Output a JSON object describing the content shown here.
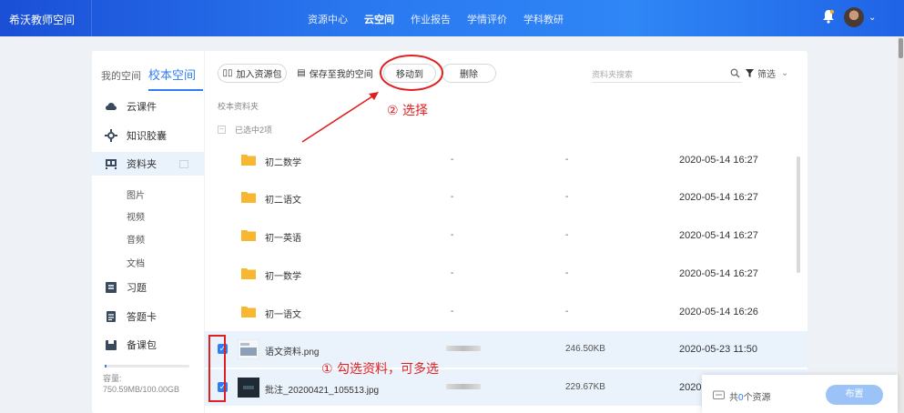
{
  "header": {
    "brand": "希沃教师空间",
    "nav": [
      {
        "label": "资源中心",
        "active": false
      },
      {
        "label": "云空间",
        "active": true
      },
      {
        "label": "作业报告",
        "active": false
      },
      {
        "label": "学情评价",
        "active": false
      },
      {
        "label": "学科教研",
        "active": false
      }
    ]
  },
  "sidebar": {
    "tabs": [
      "我的空间",
      "校本空间"
    ],
    "items": [
      {
        "label": "云课件",
        "icon": "cloud-icon"
      },
      {
        "label": "知识胶囊",
        "icon": "capsule-icon"
      },
      {
        "label": "资料夹",
        "icon": "folder-books-icon"
      },
      {
        "label": "习题",
        "icon": "exercise-icon"
      },
      {
        "label": "答题卡",
        "icon": "answer-card-icon"
      },
      {
        "label": "备课包",
        "icon": "lesson-pack-icon"
      }
    ],
    "sub_items": [
      "图片",
      "视频",
      "音频",
      "文档"
    ],
    "capacity_label": "容量:",
    "capacity_value": "750.59MB/100.00GB"
  },
  "toolbar": {
    "add_pack": "加入资源包",
    "save_mine": "保存至我的空间",
    "move_to": "移动到",
    "delete": "删除",
    "search_placeholder": "资料夹搜索",
    "filter": "筛选"
  },
  "breadcrumb": "校本资料夹",
  "selected_count": "已选中2项",
  "rows": [
    {
      "name": "初二数学",
      "col2": "-",
      "col3": "-",
      "date": "2020-05-14 16:27",
      "type": "folder",
      "checked": false
    },
    {
      "name": "初二语文",
      "col2": "-",
      "col3": "-",
      "date": "2020-05-14 16:27",
      "type": "folder",
      "checked": false
    },
    {
      "name": "初一英语",
      "col2": "-",
      "col3": "-",
      "date": "2020-05-14 16:27",
      "type": "folder",
      "checked": false
    },
    {
      "name": "初一数学",
      "col2": "-",
      "col3": "-",
      "date": "2020-05-14 16:27",
      "type": "folder",
      "checked": false
    },
    {
      "name": "初一语文",
      "col2": "-",
      "col3": "-",
      "date": "2020-05-14 16:26",
      "type": "folder",
      "checked": false
    },
    {
      "name": "语文资料.png",
      "col2": "",
      "col3": "246.50KB",
      "date": "2020-05-23 11:50",
      "type": "image",
      "checked": true
    },
    {
      "name": "批注_20200421_105513.jpg",
      "col2": "",
      "col3": "229.67KB",
      "date": "2020",
      "type": "image",
      "checked": true
    }
  ],
  "summary": {
    "prefix": "共",
    "count": "0",
    "suffix": "个资源",
    "button": "布置"
  },
  "annotations": {
    "step1": "① 勾选资料，可多选",
    "step2": "② 选择"
  },
  "colors": {
    "primary": "#2f7df5",
    "annotation": "#e02020"
  }
}
